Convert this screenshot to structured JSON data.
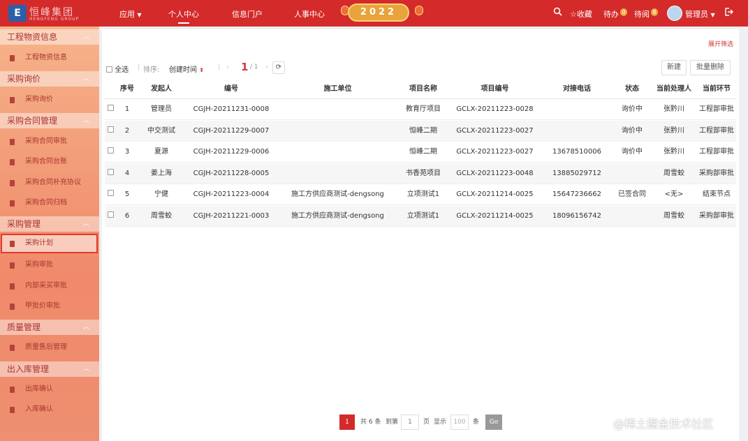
{
  "header": {
    "logo_text": "恒峰集团",
    "logo_sub": "HENGFENG GROUP",
    "nav": [
      "应用",
      "个人中心",
      "信息门户",
      "人事中心"
    ],
    "banner_year": "2022",
    "favorites_label": "收藏",
    "todo_label": "待办",
    "todo_count": "0",
    "toread_label": "待阅",
    "toread_count": "8",
    "user_label": "管理员"
  },
  "sidebar": {
    "groups": [
      {
        "title": "工程物资信息",
        "items": [
          "工程物资信息"
        ]
      },
      {
        "title": "采购询价",
        "items": [
          "采购询价"
        ]
      },
      {
        "title": "采购合同管理",
        "items": [
          "采购合同审批",
          "采购合同台账",
          "采购合同补充协议",
          "采购合同归档"
        ]
      },
      {
        "title": "采购管理",
        "items": [
          "采购计划",
          "采购审批",
          "内部采买审批",
          "甲批价审批"
        ]
      },
      {
        "title": "质量管理",
        "items": [
          "质量售后管理"
        ]
      },
      {
        "title": "出入库管理",
        "items": [
          "出库确认",
          "入库确认"
        ]
      }
    ],
    "active_item": "采购计划"
  },
  "toolbar": {
    "expand_filter": "展开筛选",
    "select_all": "全选",
    "sort_label": "排序:",
    "sort_field": "创建时间",
    "page_current": "1",
    "page_total": "/ 1",
    "new_button": "新建",
    "batch_delete_button": "批量删除"
  },
  "table": {
    "columns": [
      "序号",
      "发起人",
      "编号",
      "施工单位",
      "项目名称",
      "项目编号",
      "对接电话",
      "状态",
      "当前处理人",
      "当前环节"
    ],
    "rows": [
      [
        "1",
        "管理员",
        "CGJH-20211231-0008",
        "",
        "教育厅项目",
        "GCLX-20211223-0028",
        "",
        "询价中",
        "张黔川",
        "工程部审批"
      ],
      [
        "2",
        "中交测试",
        "CGJH-20211229-0007",
        "",
        "恒峰二期",
        "GCLX-20211223-0027",
        "",
        "询价中",
        "张黔川",
        "工程部审批"
      ],
      [
        "3",
        "夏源",
        "CGJH-20211229-0006",
        "",
        "恒峰二期",
        "GCLX-20211223-0027",
        "13678510006",
        "询价中",
        "张黔川",
        "工程部审批"
      ],
      [
        "4",
        "姜上海",
        "CGJH-20211228-0005",
        "",
        "书香苑项目",
        "GCLX-20211223-0048",
        "13885029712",
        "",
        "周雪蛟",
        "采购部审批"
      ],
      [
        "5",
        "宁健",
        "CGJH-20211223-0004",
        "施工方供应商测试-dengsong",
        "立项测试1",
        "GCLX-20211214-0025",
        "15647236662",
        "已签合同",
        "<无>",
        "结束节点"
      ],
      [
        "6",
        "周雪蛟",
        "CGJH-20211221-0003",
        "施工方供应商测试-dengsong",
        "立项测试1",
        "GCLX-20211214-0025",
        "18096156742",
        "",
        "周雪蛟",
        "采购部审批"
      ]
    ]
  },
  "pagination": {
    "current": "1",
    "total": "共 6 条",
    "goto_label": "到第",
    "goto_value": "1",
    "page_label": "页",
    "show_label": "显示",
    "page_size_placeholder": "100",
    "unit_label": "条",
    "go_button": "Go"
  },
  "watermark": "@稀土掘金技术社区",
  "colors": {
    "brand_red": "#d42a2a",
    "sidebar_top": "#f6b38a",
    "accent": "#d43a3a"
  }
}
